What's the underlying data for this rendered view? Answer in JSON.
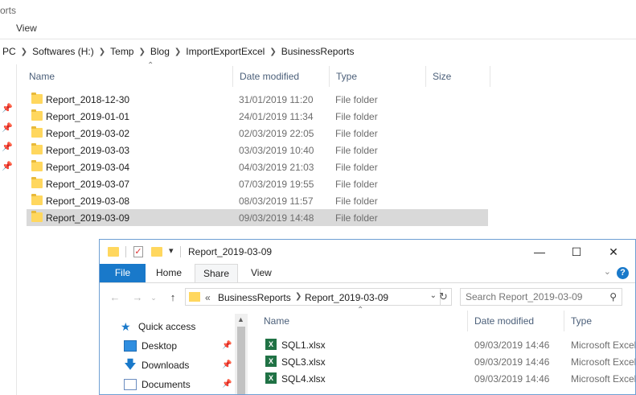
{
  "back_window": {
    "title_fragment": "orts",
    "ribbon_tab": "View",
    "breadcrumbs": [
      "PC",
      "Softwares (H:)",
      "Temp",
      "Blog",
      "ImportExportExcel",
      "BusinessReports"
    ],
    "columns": {
      "name": "Name",
      "date": "Date modified",
      "type": "Type",
      "size": "Size"
    },
    "rows": [
      {
        "name": "Report_2018-12-30",
        "date": "31/01/2019 11:20",
        "type": "File folder"
      },
      {
        "name": "Report_2019-01-01",
        "date": "24/01/2019 11:34",
        "type": "File folder"
      },
      {
        "name": "Report_2019-03-02",
        "date": "02/03/2019 22:05",
        "type": "File folder"
      },
      {
        "name": "Report_2019-03-03",
        "date": "03/03/2019 10:40",
        "type": "File folder"
      },
      {
        "name": "Report_2019-03-04",
        "date": "04/03/2019 21:03",
        "type": "File folder"
      },
      {
        "name": "Report_2019-03-07",
        "date": "07/03/2019 19:55",
        "type": "File folder"
      },
      {
        "name": "Report_2019-03-08",
        "date": "08/03/2019 11:57",
        "type": "File folder"
      },
      {
        "name": "Report_2019-03-09",
        "date": "09/03/2019 14:48",
        "type": "File folder",
        "selected": true
      }
    ]
  },
  "front_window": {
    "title": "Report_2019-03-09",
    "tabs": {
      "file": "File",
      "home": "Home",
      "share": "Share",
      "view": "View"
    },
    "help": "?",
    "address": {
      "prefix": "«",
      "crumbs": [
        "BusinessReports",
        "Report_2019-03-09"
      ]
    },
    "search_placeholder": "Search Report_2019-03-09",
    "nav": [
      {
        "label": "Quick access",
        "icon": "star-icon"
      },
      {
        "label": "Desktop",
        "icon": "desktop-icon",
        "pinned": true
      },
      {
        "label": "Downloads",
        "icon": "download-icon",
        "pinned": true
      },
      {
        "label": "Documents",
        "icon": "documents-icon",
        "pinned": true
      }
    ],
    "columns": {
      "name": "Name",
      "date": "Date modified",
      "type": "Type"
    },
    "files": [
      {
        "name": "SQL1.xlsx",
        "date": "09/03/2019 14:46",
        "type": "Microsoft Excel Worksheet"
      },
      {
        "name": "SQL3.xlsx",
        "date": "09/03/2019 14:46",
        "type": "Microsoft Excel Worksheet"
      },
      {
        "name": "SQL4.xlsx",
        "date": "09/03/2019 14:46",
        "type": "Microsoft Excel Worksheet"
      }
    ]
  },
  "colors": {
    "accent": "#1979ca",
    "folder": "#ffd75e",
    "selection": "#d9d9d9",
    "excel": "#207245"
  }
}
